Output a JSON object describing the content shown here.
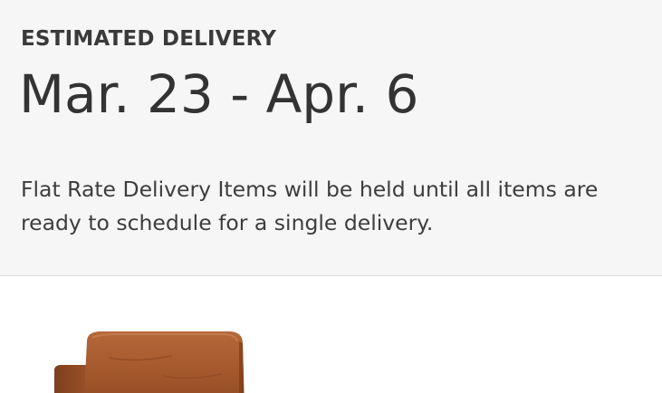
{
  "delivery": {
    "heading": "ESTIMATED DELIVERY",
    "date_range": "Mar. 23 - Apr. 6",
    "note": "Flat Rate Delivery Items will be held until all items are ready to schedule for a single delivery."
  },
  "product": {
    "image_description": "Tan leather armchair",
    "image_colors": {
      "leather_main": "#a4582c",
      "leather_dark": "#7e3f1c",
      "leather_highlight": "#c27a48"
    }
  },
  "colors": {
    "panel_background": "#f6f6f6",
    "text": "#333333",
    "divider": "#dcdcdc"
  }
}
